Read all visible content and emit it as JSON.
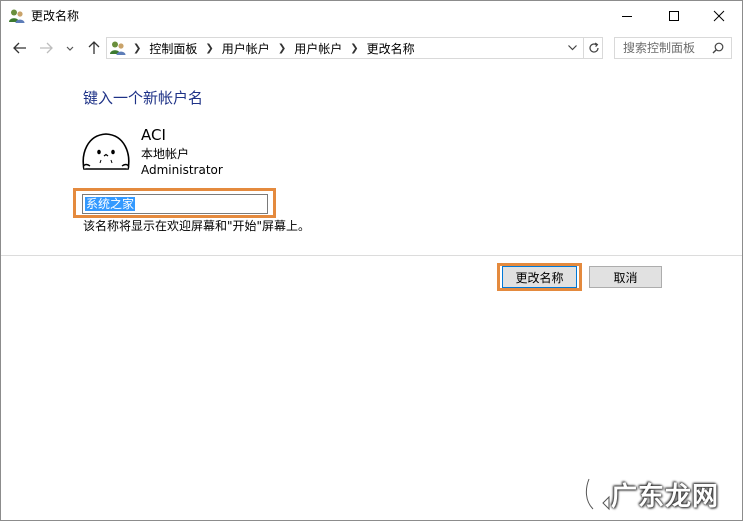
{
  "window": {
    "title": "更改名称",
    "controls": {
      "minimize": "minimize",
      "maximize": "maximize",
      "close": "close"
    }
  },
  "navigation": {
    "breadcrumbs": [
      "控制面板",
      "用户帐户",
      "用户帐户",
      "更改名称"
    ],
    "search_placeholder": "搜索控制面板"
  },
  "content": {
    "heading": "键入一个新帐户名",
    "account": {
      "name": "ACI",
      "type": "本地帐户",
      "group": "Administrator"
    },
    "new_name_value": "系统之家",
    "hint": "该名称将显示在欢迎屏幕和\"开始\"屏幕上。"
  },
  "actions": {
    "rename_label": "更改名称",
    "cancel_label": "取消"
  },
  "watermark": {
    "text": "广东龙网"
  },
  "colors": {
    "heading": "#1e3287",
    "highlight": "#e48a3e",
    "primary_border": "#0078d7",
    "selection": "#3399ff"
  }
}
